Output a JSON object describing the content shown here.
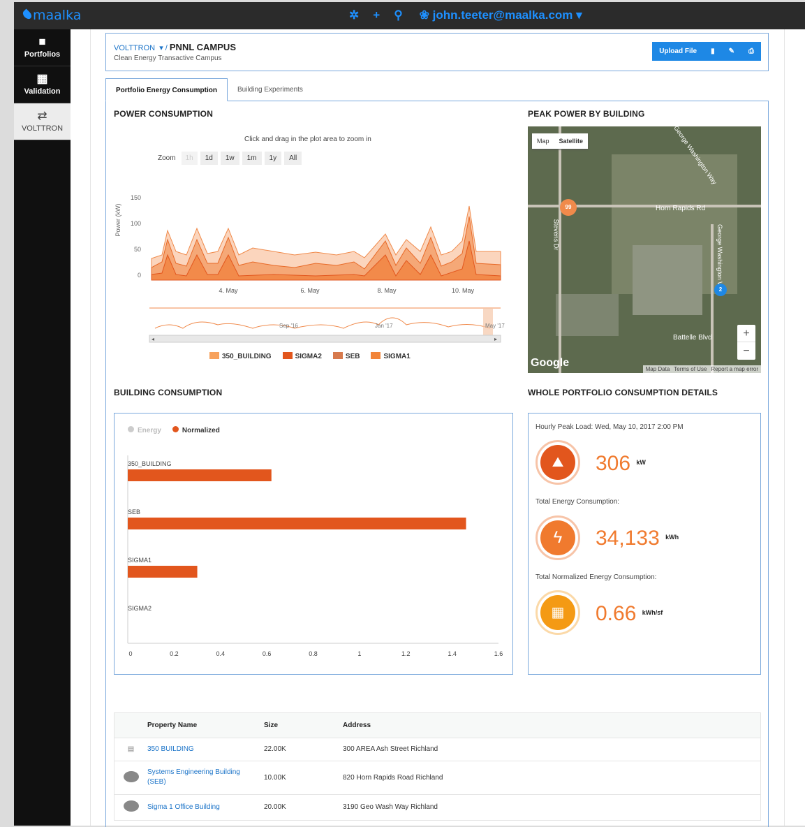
{
  "app": {
    "logo": "maalka",
    "user": "john.teeter@maalka.com"
  },
  "sidebar": {
    "items": [
      {
        "label": "Portfolios",
        "icon": "briefcase-icon"
      },
      {
        "label": "Validation",
        "icon": "calculator-icon"
      },
      {
        "label": "VOLTTRON",
        "icon": "arrows-icon"
      }
    ]
  },
  "header": {
    "parent": "VOLTTRON",
    "title": "PNNL CAMPUS",
    "subtitle": "Clean Energy Transactive Campus",
    "upload_label": "Upload File"
  },
  "tabs": [
    "Portfolio Energy Consumption",
    "Building Experiments"
  ],
  "power": {
    "title": "POWER CONSUMPTION",
    "hint": "Click and drag in the plot area to zoom in",
    "zoom_label": "Zoom",
    "zoom_options": [
      "1h",
      "1d",
      "1w",
      "1m",
      "1y",
      "All"
    ],
    "ylabel": "Power (kW)",
    "yticks": [
      "150",
      "100",
      "50",
      "0"
    ],
    "xticks": [
      "4. May",
      "6. May",
      "8. May",
      "10. May"
    ],
    "nav_labels": [
      "Sep '16",
      "Jan '17",
      "May '17"
    ],
    "legend": [
      {
        "name": "350_BUILDING",
        "color": "#f7a25d"
      },
      {
        "name": "SIGMA2",
        "color": "#e2561d"
      },
      {
        "name": "SEB",
        "color": "#d77a4d"
      },
      {
        "name": "SIGMA1",
        "color": "#f2853a"
      }
    ]
  },
  "map": {
    "title": "PEAK POWER BY BUILDING",
    "map_btn": "Map",
    "sat_btn": "Satellite",
    "roads": [
      "Horn Rapids Rd",
      "George Washington Way",
      "Stevens Dr",
      "Battelle Blvd",
      "George Washington Way"
    ],
    "cluster1": "99",
    "cluster2": "2",
    "google": "Google",
    "footer": [
      "Map Data",
      "Terms of Use",
      "Report a map error"
    ],
    "zoom_in": "+",
    "zoom_out": "−"
  },
  "building": {
    "title": "BUILDING CONSUMPTION",
    "legend": [
      "Energy",
      "Normalized"
    ],
    "xticks": [
      "0",
      "0.2",
      "0.4",
      "0.6",
      "0.8",
      "1",
      "1.2",
      "1.4",
      "1.6"
    ]
  },
  "chart_data": {
    "type": "bar",
    "categories": [
      "350_BUILDING",
      "SEB",
      "SIGMA1",
      "SIGMA2"
    ],
    "series": [
      {
        "name": "Normalized",
        "values": [
          0.62,
          1.46,
          0.3,
          0
        ]
      }
    ],
    "xlim": [
      0,
      1.6
    ],
    "orientation": "horizontal"
  },
  "details": {
    "title": "WHOLE PORTFOLIO CONSUMPTION DETAILS",
    "peak_label": "Hourly Peak Load: Wed, May 10, 2017 2:00 PM",
    "peak_value": "306",
    "peak_unit": "kW",
    "energy_label": "Total Energy Consumption:",
    "energy_value": "34,133",
    "energy_unit": "kWh",
    "norm_label": "Total Normalized Energy Consumption:",
    "norm_value": "0.66",
    "norm_unit": "kWh/sf"
  },
  "table": {
    "headers": [
      "Property Name",
      "Size",
      "Address"
    ],
    "rows": [
      {
        "name": "350 BUILDING",
        "size": "22.00K",
        "address": "300 AREA Ash Street Richland"
      },
      {
        "name": "Systems Engineering Building (SEB)",
        "size": "10.00K",
        "address": "820 Horn Rapids Road Richland"
      },
      {
        "name": "Sigma 1 Office Building",
        "size": "20.00K",
        "address": "3190 Geo Wash Way Richland"
      }
    ]
  }
}
